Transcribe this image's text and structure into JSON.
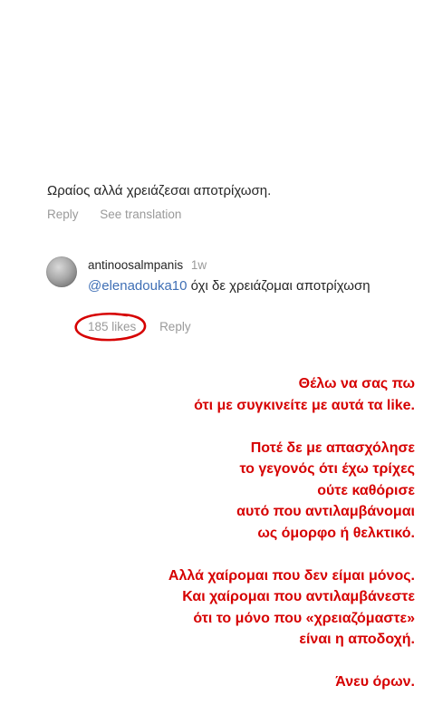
{
  "comment": {
    "text": "Ωραίος αλλά χρειάζεσαι αποτρίχωση.",
    "reply_label": "Reply",
    "see_translation_label": "See translation"
  },
  "reply": {
    "username": "antinoosalmpanis",
    "time": "1w",
    "mention": "@elenadouka10",
    "text": " όχι δε χρειάζομαι αποτρίχωση",
    "likes": "185 likes",
    "reply_label": "Reply"
  },
  "annotation_color": "#d60000",
  "story_lines": [
    "Θέλω  να σας πω",
    "ότι με συγκινείτε με αυτά τα like.",
    "",
    "Ποτέ δε με απασχόλησε",
    "το γεγονός ότι έχω τρίχες",
    "ούτε καθόρισε",
    "αυτό που αντιλαμβάνομαι",
    "ως όμορφο ή θελκτικό.",
    "",
    "Αλλά χαίρομαι που δεν είμαι μόνος.",
    "Και χαίρομαι που αντιλαμβάνεστε",
    "ότι το μόνο που «χρειαζόμαστε»",
    "είναι η αποδοχή.",
    "",
    "Άνευ όρων."
  ]
}
